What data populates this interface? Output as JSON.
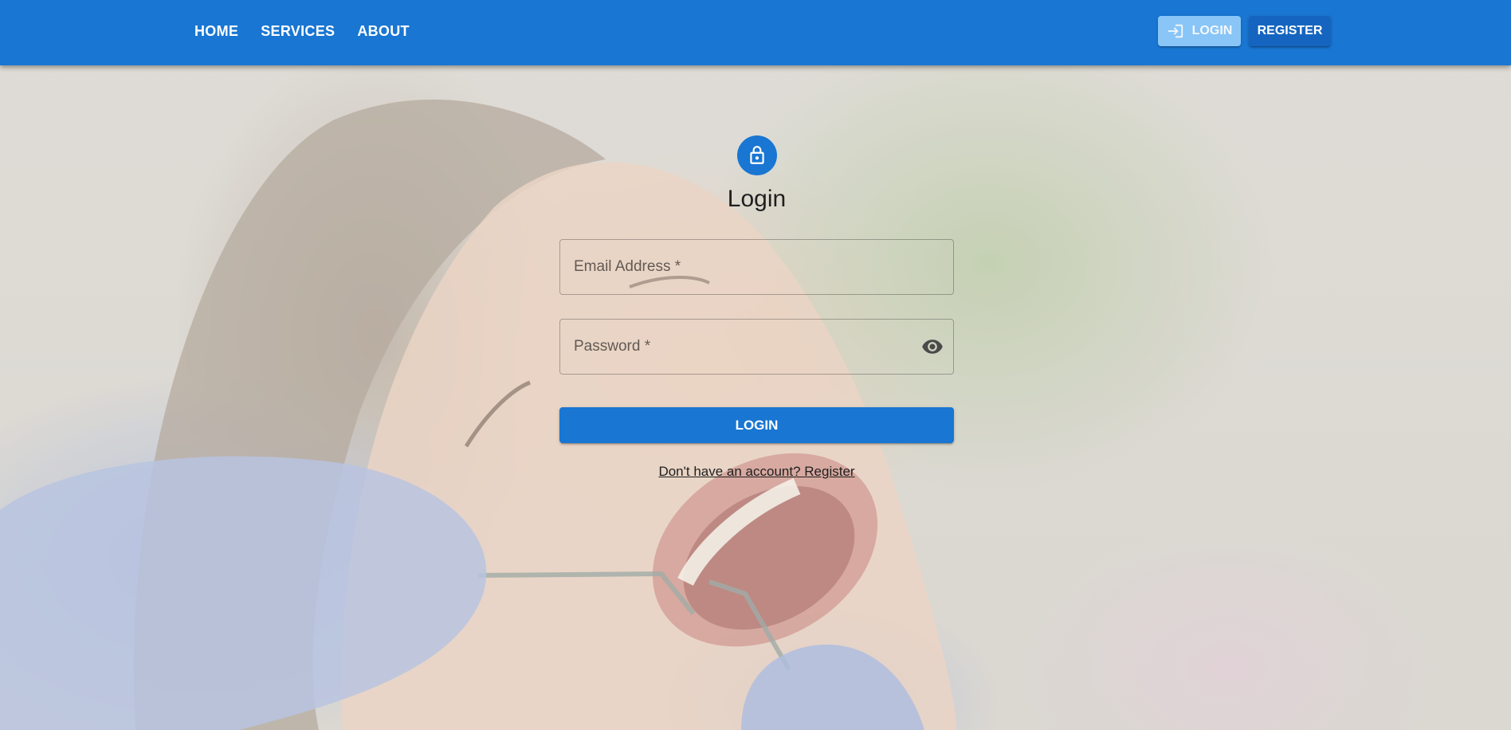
{
  "nav": {
    "home": "HOME",
    "services": "SERVICES",
    "about": "ABOUT",
    "login": "LOGIN",
    "register": "REGISTER",
    "login_icon": "login-icon"
  },
  "form": {
    "avatar_icon": "lock-icon",
    "title": "Login",
    "email_label": "Email Address *",
    "password_label": "Password *",
    "password_toggle_icon": "eye-icon",
    "submit_label": "LOGIN",
    "register_link": "Don't have an account? Register"
  },
  "colors": {
    "primary": "#1976d2",
    "primary_dark": "#1565c0",
    "primary_light": "#90caf9"
  }
}
